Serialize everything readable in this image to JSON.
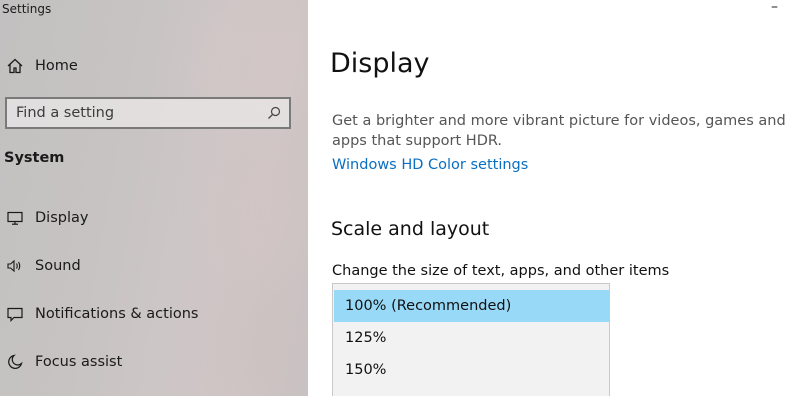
{
  "window": {
    "title": "Settings",
    "minimize_glyph": "–"
  },
  "sidebar": {
    "home": {
      "label": "Home",
      "icon": "home-icon"
    },
    "search": {
      "placeholder": "Find a setting",
      "icon": "search-icon"
    },
    "section_heading": "System",
    "items": [
      {
        "label": "Display",
        "icon": "monitor-icon"
      },
      {
        "label": "Sound",
        "icon": "speaker-icon"
      },
      {
        "label": "Notifications & actions",
        "icon": "notification-icon"
      },
      {
        "label": "Focus assist",
        "icon": "moon-icon"
      }
    ]
  },
  "main": {
    "title": "Display",
    "hdr_description": "Get a brighter and more vibrant picture for videos, games and apps that support HDR.",
    "hdr_link": "Windows HD Color settings",
    "scale_section_title": "Scale and layout",
    "scale_label": "Change the size of text, apps, and other items",
    "scale_options": [
      {
        "label": "100% (Recommended)",
        "selected": true
      },
      {
        "label": "125%",
        "selected": false
      },
      {
        "label": "150%",
        "selected": false
      }
    ]
  },
  "colors": {
    "accent_link": "#0a6fc2",
    "selected_option_bg": "#99d9f8",
    "sidebar_bg": "#c7c3c3"
  }
}
